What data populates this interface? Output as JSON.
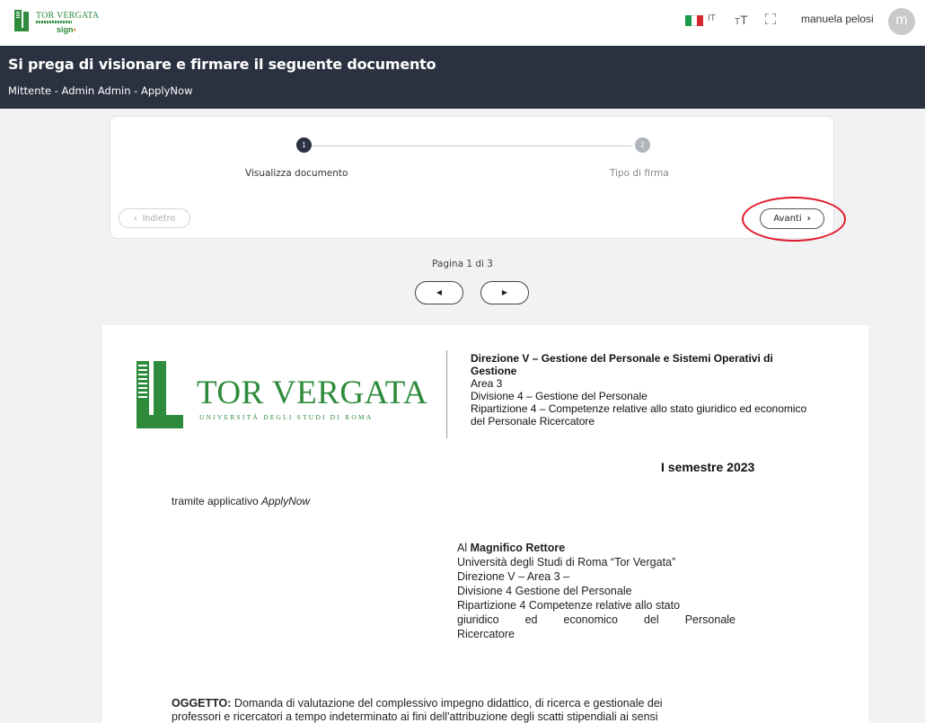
{
  "topbar": {
    "logo_text": "TOR VERGATA",
    "logo_sign": "sign",
    "lang": "IT",
    "textsize_big": "T",
    "textsize_small": "T",
    "username": "manuela pelosi",
    "avatar_initial": "m",
    "flag_colors": [
      "#1a9a4b",
      "#ffffff",
      "#d7272e"
    ]
  },
  "banner": {
    "title": "Si prega di visionare e firmare il seguente documento",
    "subtitle": "Mittente - Admin Admin - ApplyNow"
  },
  "stepper": {
    "steps": [
      {
        "number": "1",
        "label": "Visualizza documento"
      },
      {
        "number": "2",
        "label": "Tipo di firma"
      }
    ],
    "back_label": "Indietro",
    "next_label": "Avanti"
  },
  "pagination": {
    "label": "Pagina 1 di 3",
    "prev_icon": "◀",
    "next_icon": "▶"
  },
  "document": {
    "univ_name": "TOR VERGATA",
    "univ_tagline": "UNIVERSITÀ DEGLI STUDI DI ROMA",
    "dept_title": "Direzione V – Gestione del Personale e Sistemi Operativi di Gestione",
    "dept_area": "Area 3",
    "dept_division": "Divisione 4 – Gestione del Personale",
    "dept_partition": "Ripartizione 4 – Competenze relative allo stato giuridico ed economico del Personale Ricercatore",
    "semester": "I semestre 2023",
    "via_prefix": "tramite applicativo ",
    "via_app": "ApplyNow",
    "addressee_prefix": "Al ",
    "addressee_name": "Magnifico Rettore",
    "addressee_line1": "Università degli Studi di Roma “Tor Vergata”",
    "addressee_line2": "Direzione V – Area 3 –",
    "addressee_line3": "Divisione 4 Gestione del Personale",
    "addressee_line4": "Ripartizione 4 Competenze relative allo stato",
    "addressee_line5": "giuridico ed economico del Personale",
    "addressee_line6": "Ricercatore",
    "oggetto_label": "OGGETTO:",
    "oggetto_text": " Domanda di valutazione del complessivo impegno didattico, di ricerca e gestionale dei",
    "oggetto_line2": "professori e ricercatori a tempo indeterminato ai fini dell'attribuzione degli scatti stipendiali ai sensi"
  },
  "colors": {
    "banner_bg": "#2a3140",
    "brand_green": "#2e8b3c",
    "highlight_red": "#e0182a"
  }
}
